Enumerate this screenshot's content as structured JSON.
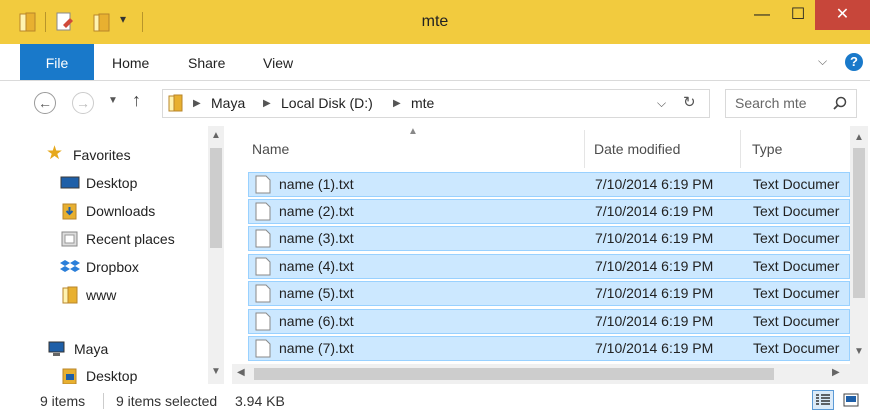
{
  "window": {
    "title": "mte"
  },
  "ribbon": {
    "tabs": [
      "File",
      "Home",
      "Share",
      "View"
    ]
  },
  "address": {
    "crumbs": [
      "Maya",
      "Local Disk (D:)",
      "mte"
    ],
    "search_placeholder": "Search mte"
  },
  "nav": {
    "favorites_label": "Favorites",
    "favorites": [
      "Desktop",
      "Downloads",
      "Recent places",
      "Dropbox",
      "www"
    ],
    "computer_label": "Maya",
    "computer_items": [
      "Desktop"
    ]
  },
  "list": {
    "columns": {
      "name": "Name",
      "date": "Date modified",
      "type": "Type"
    },
    "rows": [
      {
        "name": "name (1).txt",
        "date": "7/10/2014 6:19 PM",
        "type": "Text Documer"
      },
      {
        "name": "name (2).txt",
        "date": "7/10/2014 6:19 PM",
        "type": "Text Documer"
      },
      {
        "name": "name (3).txt",
        "date": "7/10/2014 6:19 PM",
        "type": "Text Documer"
      },
      {
        "name": "name (4).txt",
        "date": "7/10/2014 6:19 PM",
        "type": "Text Documer"
      },
      {
        "name": "name (5).txt",
        "date": "7/10/2014 6:19 PM",
        "type": "Text Documer"
      },
      {
        "name": "name (6).txt",
        "date": "7/10/2014 6:19 PM",
        "type": "Text Documer"
      },
      {
        "name": "name (7).txt",
        "date": "7/10/2014 6:19 PM",
        "type": "Text Documer"
      }
    ]
  },
  "status": {
    "items": "9 items",
    "selected": "9 items selected",
    "size": "3.94 KB"
  },
  "colors": {
    "accent": "#1979ca",
    "selection": "#cce8ff",
    "selection_border": "#99d1ff",
    "titlebar": "#f2cb3e",
    "close": "#c7463a"
  }
}
